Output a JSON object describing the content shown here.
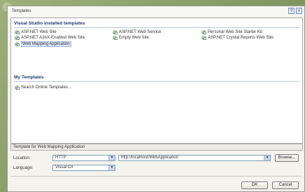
{
  "window": {
    "title": "Templates",
    "help_glyph": "?",
    "close_glyph": "×"
  },
  "sections": {
    "installed_header": "Visual Studio installed templates",
    "my_header": "My Templates"
  },
  "installed_templates": [
    {
      "label": "ASP.NET Web Site",
      "icon": "web-site-icon"
    },
    {
      "label": "ASP.NET Web Service",
      "icon": "web-service-icon"
    },
    {
      "label": "Personal Web Site Starter Kit",
      "icon": "starter-kit-icon"
    },
    {
      "label": "ASP.NET AJAX-Enabled Web Site",
      "icon": "ajax-site-icon"
    },
    {
      "label": "Empty Web Site",
      "icon": "empty-site-icon"
    },
    {
      "label": "ASP.NET Crystal Reports Web Site",
      "icon": "crystal-reports-icon"
    },
    {
      "label": "Web Mapping Application",
      "icon": "web-mapping-icon",
      "selected": true
    }
  ],
  "my_templates": [
    {
      "label": "Search Online Templates...",
      "icon": "search-online-icon"
    }
  ],
  "description": "Template for Web Mapping Application",
  "location": {
    "label": "Location:",
    "type_value": "HTTP",
    "path_value": "http://localhost/WebApplication",
    "browse_label": "Browse..."
  },
  "language": {
    "label": "Language:",
    "value": "Visual C#"
  },
  "buttons": {
    "ok": "OK",
    "cancel": "Cancel"
  },
  "colors": {
    "section_header": "#1f3b73",
    "selection": "#dbe6f7"
  }
}
